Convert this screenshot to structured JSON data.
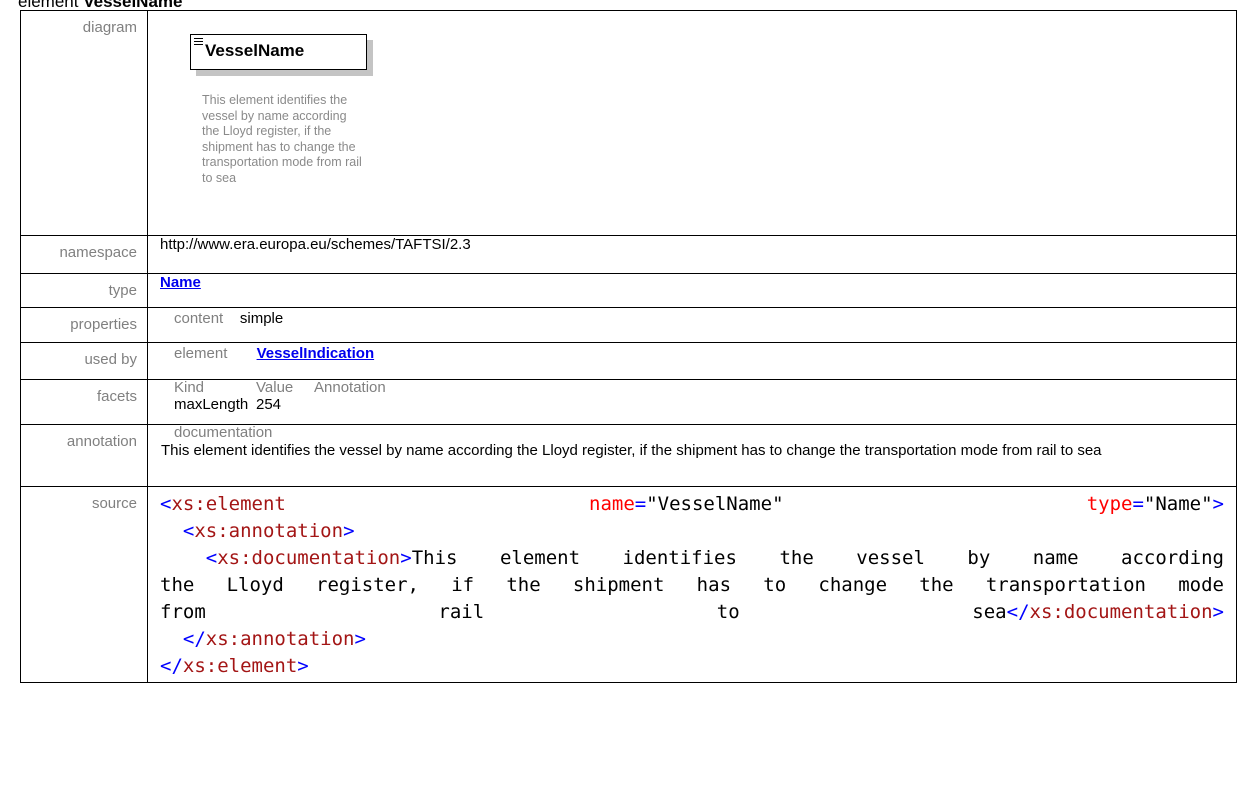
{
  "heading": {
    "prefix": "element",
    "name": "VesselName"
  },
  "diagram": {
    "label": "diagram",
    "element_name": "VesselName",
    "doc_lines": [
      "This element identifies the",
      "vessel by name according",
      "the Lloyd register, if the",
      "shipment has to change the",
      "transportation mode from rail",
      "to sea"
    ]
  },
  "namespace": {
    "label": "namespace",
    "value": "http://www.era.europa.eu/schemes/TAFTSI/2.3"
  },
  "type": {
    "label": "type",
    "value": "Name"
  },
  "properties": {
    "label": "properties",
    "key": "content",
    "value": "simple"
  },
  "used_by": {
    "label": "used by",
    "kind": "element",
    "value": "VesselIndication"
  },
  "facets": {
    "label": "facets",
    "headers": [
      "Kind",
      "Value",
      "Annotation"
    ],
    "rows": [
      {
        "kind": "maxLength",
        "value": "254",
        "annotation": ""
      }
    ]
  },
  "annotation": {
    "label": "annotation",
    "sub": "documentation",
    "text": "This element identifies the vessel by name according the Lloyd register, if the shipment has to change the transportation mode from rail to sea"
  },
  "source": {
    "label": "source",
    "element_tag": "xs:element",
    "attr_name": "name",
    "attr_name_val": "\"VesselName\"",
    "attr_type": "type",
    "attr_type_val": "\"Name\"",
    "annotation_tag": "xs:annotation",
    "documentation_tag": "xs:documentation",
    "doc_part1": "This element identifies the vessel by name according",
    "doc_part2": "the Lloyd register, if the shipment has to change the transportation mode",
    "doc_part3_a": "from",
    "doc_part3_b": "rail",
    "doc_part3_c": "to",
    "doc_part3_d": "sea"
  },
  "colors": {
    "tag": "#a31515",
    "punct": "#0000ff",
    "attr": "#ff0000",
    "link": "#0000ee",
    "label": "#808080"
  }
}
